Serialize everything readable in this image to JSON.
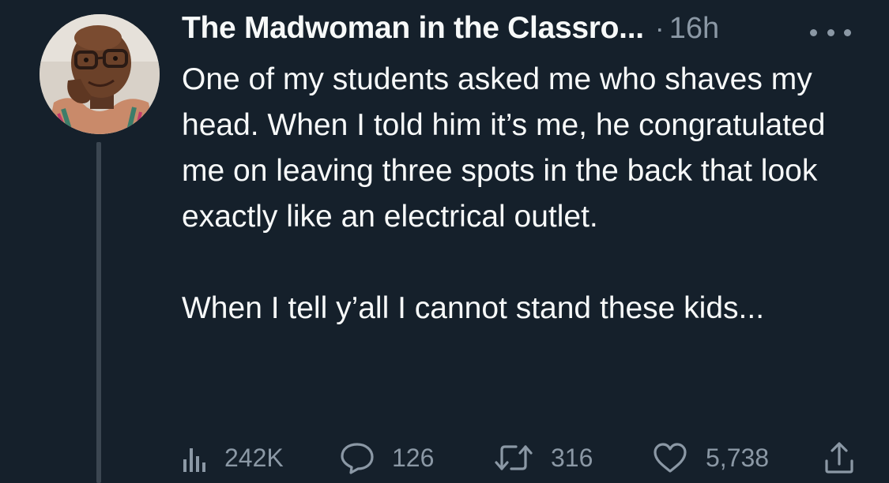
{
  "tweet": {
    "display_name": "The Madwoman in the Classro...",
    "separator": "·",
    "time": "16h",
    "paragraphs": [
      "One of my students asked me who shaves my head. When I told him it’s me, he congratulated me on leaving three spots in the back that look exactly like an electrical outlet.",
      "When I tell y’all I cannot stand these kids..."
    ]
  },
  "actions": {
    "views": {
      "icon": "bar-chart-icon",
      "count": "242K"
    },
    "replies": {
      "icon": "speech-bubble-icon",
      "count": "126"
    },
    "retweets": {
      "icon": "retweet-icon",
      "count": "316"
    },
    "likes": {
      "icon": "heart-icon",
      "count": "5,738"
    },
    "share": {
      "icon": "share-upload-icon"
    }
  },
  "colors": {
    "background": "#15202b",
    "text": "#f7f9f9",
    "secondary": "#8b98a5",
    "thread_line": "#3b4651"
  }
}
